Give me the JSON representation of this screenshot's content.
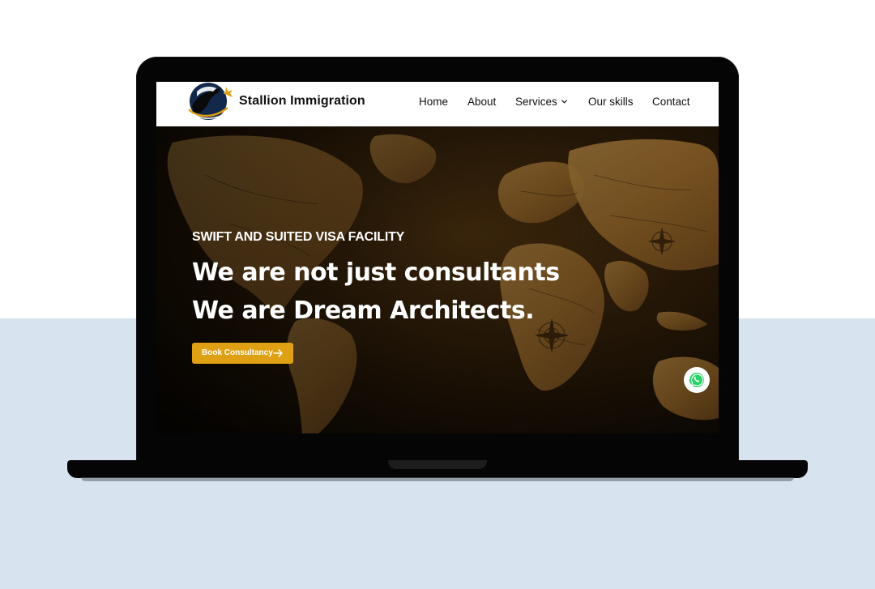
{
  "site": {
    "brand": "Stallion Immigration",
    "logo_icon": "stallion-globe-logo"
  },
  "nav": {
    "items": [
      {
        "label": "Home"
      },
      {
        "label": "About"
      },
      {
        "label": "Services",
        "icon": "chevron-down-icon"
      },
      {
        "label": "Our skills"
      },
      {
        "label": "Contact"
      }
    ]
  },
  "hero": {
    "eyebrow": "SWIFT AND SUITED VISA FACILITY",
    "headline_line1": "We are not just consultants",
    "headline_line2": "We are Dream Architects.",
    "cta_label": "Book Consultancy",
    "cta_icon": "arrow-right-icon",
    "background": "vintage-world-map"
  },
  "floating": {
    "whatsapp_icon": "whatsapp-icon"
  },
  "colors": {
    "accent": "#e0a013",
    "backdrop_lower": "#d7e3ee",
    "laptop": "#050505",
    "whatsapp": "#25d366"
  }
}
